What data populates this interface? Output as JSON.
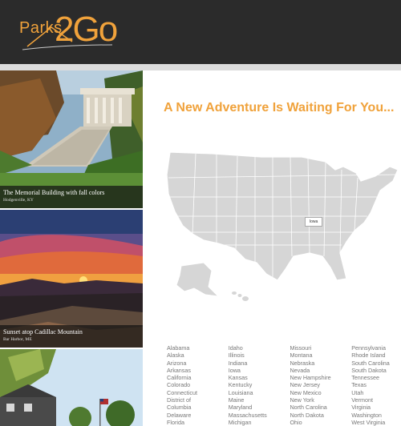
{
  "header": {
    "logo_parks": "Parks",
    "logo_2go": "2Go"
  },
  "feed": {
    "cards": [
      {
        "title": "The Memorial Building with fall colors",
        "location": "Hodgenville, KY"
      },
      {
        "title": "Sunset atop Cadillac Mountain",
        "location": "Bar Harbor, ME"
      },
      {
        "title": "",
        "location": ""
      }
    ]
  },
  "main": {
    "headline": "A New Adventure Is Waiting For You...",
    "map_tooltip": "Iowa",
    "states": [
      [
        "Alabama",
        "Alaska",
        "Arizona",
        "Arkansas",
        "California",
        "Colorado",
        "Connecticut",
        "District of",
        "Columbia",
        "Delaware",
        "Florida"
      ],
      [
        "Idaho",
        "Illinois",
        "Indiana",
        "Iowa",
        "Kansas",
        "Kentucky",
        "Louisiana",
        "Maine",
        "Maryland",
        "Massachusetts",
        "Michigan"
      ],
      [
        "Missouri",
        "Montana",
        "Nebraska",
        "Nevada",
        "New Hampshire",
        "New Jersey",
        "New Mexico",
        "New York",
        "North Carolina",
        "North Dakota",
        "Ohio"
      ],
      [
        "Pennsylvania",
        "Rhode Island",
        "South Carolina",
        "South Dakota",
        "Tennessee",
        "Texas",
        "Utah",
        "Vermont",
        "Virginia",
        "Washington",
        "West Virginia"
      ]
    ]
  },
  "colors": {
    "brand_orange": "#f0a23b",
    "header_bg": "#2b2b2b",
    "map_fill": "#d6d6d6",
    "map_border": "#ffffff"
  }
}
